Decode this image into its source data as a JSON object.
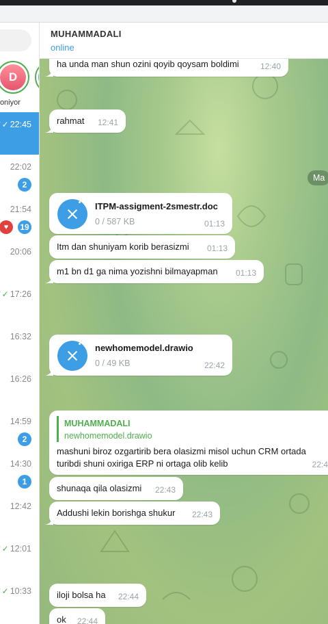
{
  "sidebar": {
    "stories": [
      {
        "initial": "D",
        "name": "Doniyor"
      }
    ],
    "rows": [
      {
        "time": "22:45",
        "read": true,
        "active": true
      },
      {
        "time": "22:02",
        "badge": "2"
      },
      {
        "time": "21:54",
        "badge": "19",
        "reaction": "heart"
      },
      {
        "time": "20:06"
      },
      {
        "time": "17:26",
        "read": true
      },
      {
        "time": "16:32"
      },
      {
        "time": "16:26"
      },
      {
        "time": "14:59",
        "badge": "2"
      },
      {
        "time": "14:30",
        "badge": "1"
      },
      {
        "time": "12:42"
      },
      {
        "time": "12:01",
        "read": true
      },
      {
        "time": "10:33",
        "read": true
      }
    ]
  },
  "header": {
    "name": "MUHAMMADALI",
    "status": "online"
  },
  "service_label": "Ma",
  "messages": [
    {
      "text": "ha unda man shun ozini qoyib qoysam boldimi",
      "time": "12:40"
    },
    {
      "text": "rahmat",
      "time": "12:41"
    },
    {
      "file": "ITPM-assigment-2smestr.doc",
      "size": "0 / 587 KB",
      "time": "01:13"
    },
    {
      "text": "Itm dan shuniyam korib berasizmi",
      "time": "01:13"
    },
    {
      "text": "m1 bn d1 ga nima yozishni bilmayapman",
      "time": "01:13"
    },
    {
      "file": "newhomemodel.drawio",
      "size": "0 / 49 KB",
      "time": "22:42"
    },
    {
      "reply_name": "MUHAMMADALI",
      "reply_text": "newhomemodel.drawio",
      "text_line1": "mashuni biroz ozgartirib bera olasizmi misol uchun CRM ortada",
      "text_line2": "turibdi shuni oxiriga ERP ni ortaga olib kelib",
      "time": "22:4"
    },
    {
      "text": "shunaqa qila olasizmi",
      "time": "22:43"
    },
    {
      "text": "Addushi lekin borishga shukur",
      "time": "22:43"
    },
    {
      "text": "iloji bolsa ha",
      "time": "22:44"
    },
    {
      "text": "ok",
      "time": "22:44"
    }
  ],
  "colors": {
    "accent": "#3d9ee5",
    "green": "#4fae4e",
    "bubble": "#ffffff"
  }
}
